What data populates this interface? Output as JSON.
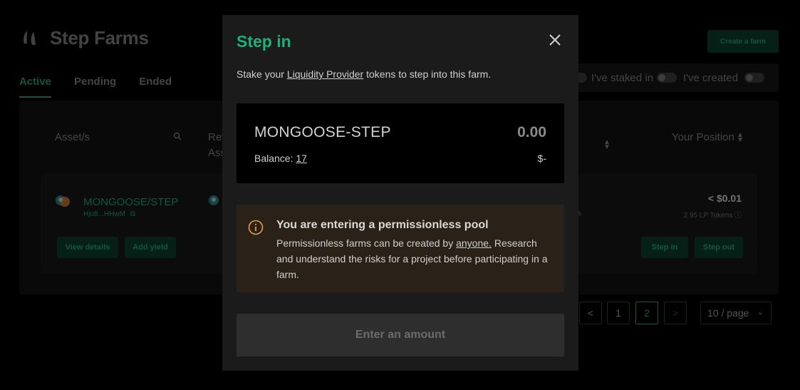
{
  "app": {
    "title": "Step Farms",
    "create_farm_label": "Create a farm"
  },
  "tabs": [
    {
      "label": "Active",
      "active": true
    },
    {
      "label": "Pending",
      "active": false
    },
    {
      "label": "Ended",
      "active": false
    }
  ],
  "filters": {
    "staked_label": "I've staked in",
    "created_label": "I've created"
  },
  "table": {
    "col_asset": "Asset/s",
    "col_rewards_line1": "Rev",
    "col_rewards_line2": "Ass",
    "col_position": "Your Position",
    "row": {
      "pair": "MONGOOSE/STEP",
      "address": "Hju8...HHwM",
      "view_details": "View details",
      "add_yield": "Add yield",
      "position_value": "< $0.01",
      "lp_tokens": "2.95 LP Tokens",
      "step_in": "Step in",
      "step_out": "Step out",
      "fragment": "s"
    }
  },
  "pagination": {
    "prev": "<",
    "pages": [
      "1",
      "2"
    ],
    "current": "2",
    "next": ">",
    "page_size": "10 / page"
  },
  "modal": {
    "title": "Step in",
    "subtitle_prefix": "Stake your ",
    "subtitle_link": "Liquidity Provider",
    "subtitle_suffix": " tokens to step into this farm.",
    "token_name": "MONGOOSE-STEP",
    "token_amount": "0.00",
    "balance_label": "Balance: ",
    "balance_value": "17",
    "usd_value": "$-",
    "warning_title": "You are entering a permissionless pool",
    "warning_prefix": "Permissionless farms can be created by ",
    "warning_link": "anyone.",
    "warning_suffix": " Research and understand the risks for a project before participating in a farm.",
    "submit_label": "Enter an amount"
  },
  "colors": {
    "accent": "#1fb07a",
    "warning_bg": "#2a2118",
    "warning_icon": "#e0a040"
  }
}
